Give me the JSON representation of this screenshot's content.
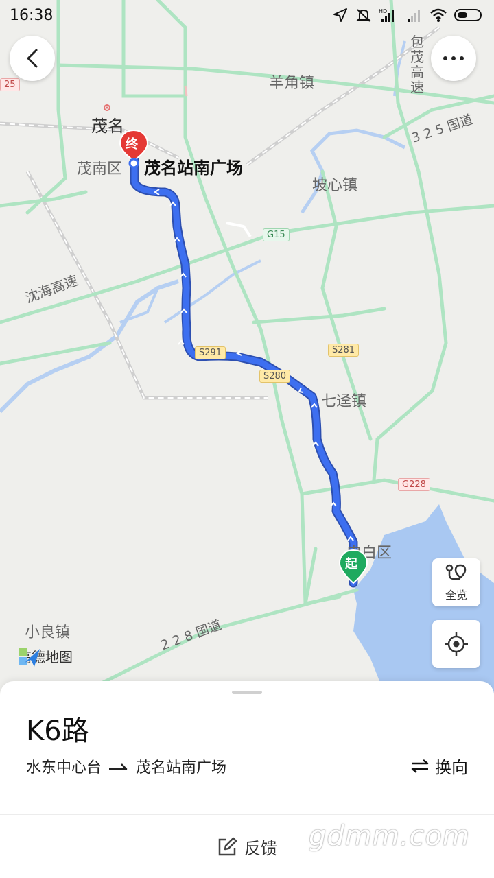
{
  "status_bar": {
    "time": "16:38"
  },
  "map": {
    "labels": {
      "yangjiao": "羊角镇",
      "maoming": "茂名",
      "maonan": "茂南区",
      "destination": "茂名站南广场",
      "poxin": "坡心镇",
      "shenhai": "沈海高速",
      "qijing": "七迳镇",
      "dianbai": "电白区",
      "xiaoliang": "小良镇",
      "baomao": "包茂高速",
      "guodao325": "3 2 5 国道",
      "guodao228": "2 2 8 国道"
    },
    "shields": {
      "g15": "G15",
      "s291": "S291",
      "s280": "S280",
      "s281": "S281",
      "g228": "G228",
      "left_edge": "25"
    },
    "markers": {
      "end": "终",
      "start": "起"
    },
    "logo_text": "高德地图"
  },
  "buttons": {
    "overview_label": "全览"
  },
  "route": {
    "name": "K6路",
    "from": "水东中心台",
    "to": "茂名站南广场",
    "swap_label": "换向",
    "feedback_label": "反馈"
  },
  "watermark": "gdmm.com",
  "colors": {
    "route": "#3d6ff0",
    "start": "#1faa5f",
    "end": "#e53935",
    "road": "#aee4c2"
  }
}
